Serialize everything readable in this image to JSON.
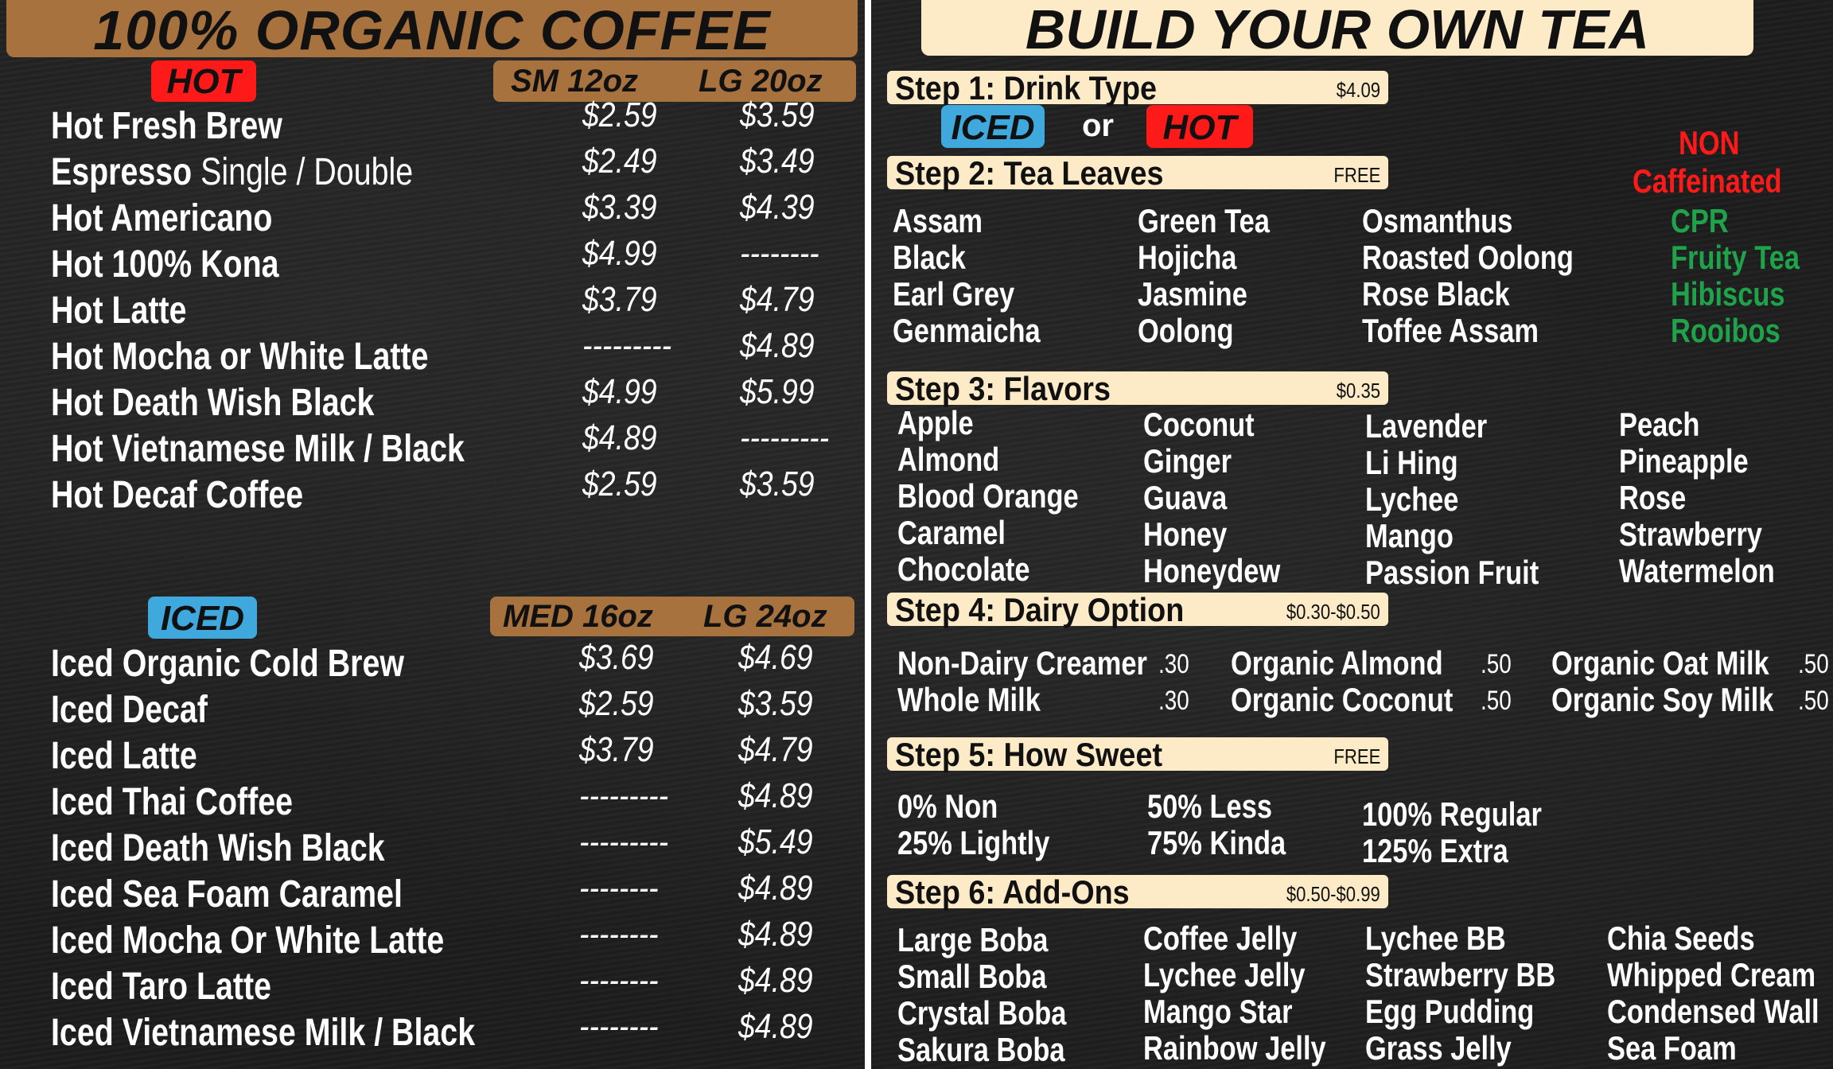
{
  "coffee": {
    "title": "100% ORGANIC COFFEE",
    "hot": {
      "badge": "HOT",
      "size_sm": "SM  12oz",
      "size_lg": "LG  20oz",
      "items": [
        {
          "name": "Hot Fresh Brew",
          "sm": "$2.59",
          "lg": "$3.59"
        },
        {
          "name": "Espresso",
          "name_suffix": " Single / Double",
          "sm": "$2.49",
          "lg": "$3.49"
        },
        {
          "name": "Hot Americano",
          "sm": "$3.39",
          "lg": "$4.39"
        },
        {
          "name": "Hot 100% Kona",
          "sm": "$4.99",
          "lg": "--------"
        },
        {
          "name": "Hot Latte",
          "sm": "$3.79",
          "lg": "$4.79"
        },
        {
          "name": "Hot Mocha or White Latte",
          "sm": "---------",
          "lg": "$4.89"
        },
        {
          "name": "Hot Death Wish Black",
          "sm": "$4.99",
          "lg": "$5.99"
        },
        {
          "name": "Hot Vietnamese Milk / Black",
          "sm": "$4.89",
          "lg": "---------"
        },
        {
          "name": "Hot Decaf Coffee",
          "sm": "$2.59",
          "lg": "$3.59"
        }
      ]
    },
    "iced": {
      "badge": "ICED",
      "size_med": "MED  16oz",
      "size_lg": "LG  24oz",
      "items": [
        {
          "name": "Iced Organic Cold Brew",
          "med": "$3.69",
          "lg": "$4.69"
        },
        {
          "name": "Iced Decaf",
          "med": "$2.59",
          "lg": "$3.59"
        },
        {
          "name": "Iced Latte",
          "med": "$3.79",
          "lg": "$4.79"
        },
        {
          "name": "Iced Thai Coffee",
          "med": "---------",
          "lg": "$4.89"
        },
        {
          "name": "Iced Death Wish Black",
          "med": "---------",
          "lg": "$5.49"
        },
        {
          "name": "Iced Sea Foam Caramel",
          "med": "--------",
          "lg": "$4.89"
        },
        {
          "name": "Iced Mocha Or White Latte",
          "med": "--------",
          "lg": "$4.89"
        },
        {
          "name": "Iced Taro Latte",
          "med": "--------",
          "lg": "$4.89"
        },
        {
          "name": "Iced Vietnamese Milk / Black",
          "med": "--------",
          "lg": "$4.89"
        }
      ]
    }
  },
  "tea": {
    "title": "BUILD YOUR OWN TEA",
    "step1": {
      "label": "Step 1: Drink Type",
      "price": "$4.09",
      "iced": "ICED",
      "or": "or",
      "hot": "HOT"
    },
    "step2": {
      "label": "Step 2: Tea Leaves",
      "price": "FREE",
      "non_caffeinated_label_1": "NON",
      "non_caffeinated_label_2": "Caffeinated",
      "columns": [
        [
          "Assam",
          "Black",
          "Earl Grey",
          "Genmaicha"
        ],
        [
          "Green Tea",
          "Hojicha",
          "Jasmine",
          "Oolong"
        ],
        [
          "Osmanthus",
          "Roasted Oolong",
          "Rose Black",
          "Toffee Assam"
        ],
        [
          "CPR",
          "Fruity Tea",
          "Hibiscus",
          "Rooibos"
        ]
      ]
    },
    "step3": {
      "label": "Step 3: Flavors",
      "price": "$0.35",
      "columns": [
        [
          "Apple",
          "Almond",
          "Blood Orange",
          "Caramel",
          "Chocolate"
        ],
        [
          "Coconut",
          "Ginger",
          "Guava",
          "Honey",
          "Honeydew"
        ],
        [
          "Lavender",
          "Li Hing",
          "Lychee",
          "Mango",
          "Passion Fruit"
        ],
        [
          "Peach",
          "Pineapple",
          "Rose",
          "Strawberry",
          "Watermelon"
        ]
      ]
    },
    "step4": {
      "label": "Step 4: Dairy Option",
      "price": "$0.30-$0.50",
      "columns": [
        [
          {
            "name": "Non-Dairy Creamer",
            "price": ".30"
          },
          {
            "name": "Whole Milk",
            "price": ".30"
          }
        ],
        [
          {
            "name": "Organic Almond",
            "price": ".50"
          },
          {
            "name": "Organic Coconut",
            "price": ".50"
          }
        ],
        [
          {
            "name": "Organic Oat Milk",
            "price": ".50"
          },
          {
            "name": "Organic Soy Milk",
            "price": ".50"
          }
        ]
      ]
    },
    "step5": {
      "label": "Step 5: How Sweet",
      "price": "FREE",
      "columns": [
        [
          "0%   Non",
          "25% Lightly"
        ],
        [
          "50% Less",
          "75% Kinda"
        ],
        [
          "100% Regular",
          "125% Extra"
        ]
      ]
    },
    "step6": {
      "label": "Step 6: Add-Ons",
      "price": "$0.50-$0.99",
      "columns": [
        [
          "Large Boba",
          "Small Boba",
          "Crystal Boba",
          "Sakura Boba"
        ],
        [
          "Coffee Jelly",
          "Lychee Jelly",
          "Mango Star",
          "Rainbow Jelly"
        ],
        [
          "Lychee BB",
          "Strawberry BB",
          "Egg Pudding",
          "Grass Jelly"
        ],
        [
          "Chia Seeds",
          "Whipped Cream",
          "Condensed Wall",
          "Sea Foam"
        ]
      ]
    }
  },
  "colors": {
    "coffee_header": "#a8723e",
    "tea_header": "#fdebc8",
    "hot": "#ff1a1a",
    "iced": "#3fa9de",
    "non_caffeinated": "#1fa34a"
  }
}
